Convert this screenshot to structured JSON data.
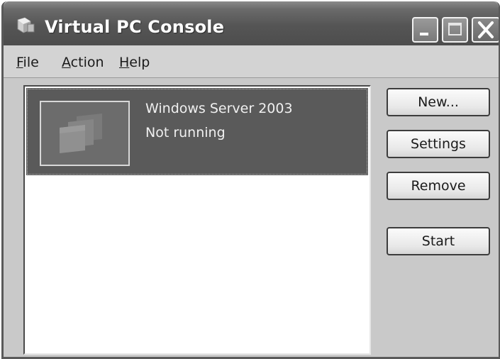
{
  "window": {
    "title": "Virtual PC Console",
    "title_icon": "virtual-pc-icon"
  },
  "title_buttons": {
    "minimize_icon": "minimize-icon",
    "maximize_icon": "maximize-icon",
    "close_icon": "close-icon"
  },
  "menu": [
    {
      "mnemonic": "F",
      "rest": "ile"
    },
    {
      "mnemonic": "A",
      "rest": "ction"
    },
    {
      "mnemonic": "H",
      "rest": "elp"
    }
  ],
  "vm_list": {
    "items": [
      {
        "name": "Windows Server 2003",
        "status": "Not running",
        "thumbnail_icon": "vm-windows-thumbnail-icon",
        "selected": true
      }
    ]
  },
  "actions": {
    "new_label": "New...",
    "settings_label": "Settings",
    "remove_label": "Remove",
    "start_label": "Start"
  },
  "colors": {
    "titlebar": "#555555",
    "selection": "#5a5a5a",
    "window_background": "#c9c9c9"
  }
}
